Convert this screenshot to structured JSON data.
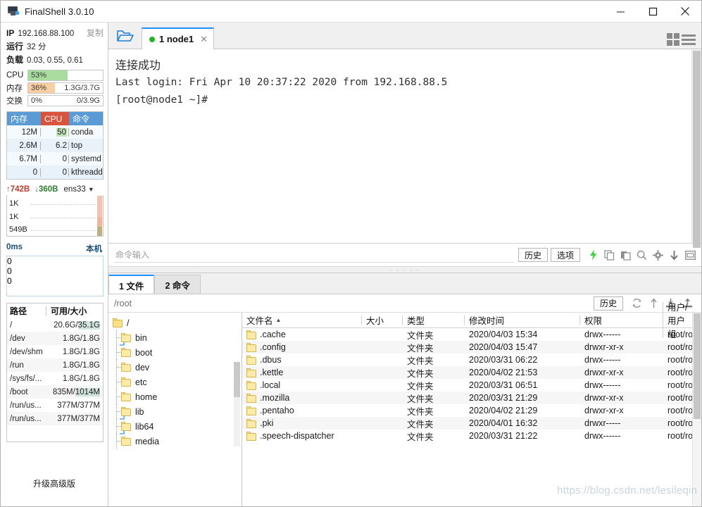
{
  "window": {
    "title": "FinalShell 3.0.10",
    "icon": "monitor-icon",
    "minimize": "–",
    "maximize": "□",
    "close": "✕"
  },
  "monitor": {
    "ip_label": "IP",
    "ip_value": "192.168.88.100",
    "copy_label": "复制",
    "uptime_label": "运行",
    "uptime_value": "32 分",
    "load_label": "负载",
    "load_value": "0.03, 0.55, 0.61",
    "meters": [
      {
        "name": "CPU",
        "pct_text": "53%",
        "pct": 53,
        "amount": "",
        "color": "#a8dd9e"
      },
      {
        "name": "内存",
        "pct_text": "36%",
        "pct": 36,
        "amount": "1.3G/3.7G",
        "color": "#fbcfa4"
      },
      {
        "name": "交换",
        "pct_text": "0%",
        "pct": 0,
        "amount": "0/3.9G",
        "color": "#cfe8f5"
      }
    ],
    "process_headers": {
      "mem": "内存",
      "cpu": "CPU",
      "cmd": "命令"
    },
    "processes": [
      {
        "mem": "12M",
        "cpu": "50",
        "cpu_hl": true,
        "cmd": "conda"
      },
      {
        "mem": "2.6M",
        "cpu": "6.2",
        "cpu_hl": false,
        "cmd": "top"
      },
      {
        "mem": "6.7M",
        "cpu": "0",
        "cpu_hl": false,
        "cmd": "systemd"
      },
      {
        "mem": "0",
        "cpu": "0",
        "cpu_hl": false,
        "cmd": "kthreadd"
      }
    ],
    "net": {
      "up_arrow": "↑",
      "up_value": "742B",
      "down_arrow": "↓",
      "down_value": "360B",
      "interface": "ens33",
      "caret": "▼",
      "axis": [
        "1K",
        "1K",
        "549B"
      ]
    },
    "latency": {
      "value": "0ms",
      "target": "本机",
      "axis": [
        "0",
        "0",
        "0"
      ]
    },
    "disk_headers": {
      "path": "路径",
      "usage": "可用/大小"
    },
    "disks": [
      {
        "path": "/",
        "free": "20.6G",
        "total": "35.1G",
        "highlight": true
      },
      {
        "path": "/dev",
        "free": "1.8G",
        "total": "1.8G",
        "highlight": false
      },
      {
        "path": "/dev/shm",
        "free": "1.8G",
        "total": "1.8G",
        "highlight": false
      },
      {
        "path": "/run",
        "free": "1.8G",
        "total": "1.8G",
        "highlight": false
      },
      {
        "path": "/sys/fs/...",
        "free": "1.8G",
        "total": "1.8G",
        "highlight": false
      },
      {
        "path": "/boot",
        "free": "835M",
        "total": "1014M",
        "highlight": true
      },
      {
        "path": "/run/us...",
        "free": "377M",
        "total": "377M",
        "highlight": false
      },
      {
        "path": "/run/us...",
        "free": "377M",
        "total": "377M",
        "highlight": false
      }
    ],
    "upgrade_label": "升级高级版"
  },
  "tabs": {
    "folder_icon": "open-folder-icon",
    "items": [
      {
        "label": "1 node1",
        "status": "connected",
        "close": "✕"
      }
    ],
    "grid_view_icon": "grid-view-icon",
    "list_view_icon": "list-view-icon"
  },
  "terminal": {
    "lines": [
      "连接成功",
      "Last login: Fri Apr 10 20:37:22 2020 from 192.168.88.5",
      "[root@node1 ~]#"
    ]
  },
  "command_bar": {
    "placeholder": "命令输入",
    "value": "",
    "history_label": "历史",
    "options_label": "选项",
    "icons": [
      "lightning-icon",
      "copy-icon",
      "paste-icon",
      "search-icon",
      "gear-icon",
      "download-icon",
      "window-icon"
    ]
  },
  "bottom_tabs": [
    {
      "label": "1 文件",
      "active": true
    },
    {
      "label": "2 命令",
      "active": false
    }
  ],
  "file_manager": {
    "path": "/root",
    "history_label": "历史",
    "icons": [
      "refresh-icon",
      "up-directory-icon",
      "download-file-icon",
      "upload-file-icon"
    ],
    "tree_root": "/",
    "tree": [
      {
        "label": "bin",
        "link": true
      },
      {
        "label": "boot",
        "link": false
      },
      {
        "label": "dev",
        "link": false
      },
      {
        "label": "etc",
        "link": false
      },
      {
        "label": "home",
        "link": false
      },
      {
        "label": "lib",
        "link": true
      },
      {
        "label": "lib64",
        "link": true
      },
      {
        "label": "media",
        "link": false
      }
    ],
    "columns": [
      {
        "key": "name",
        "label": "文件名",
        "sorted": true,
        "arrow": "▲"
      },
      {
        "key": "size",
        "label": "大小",
        "sorted": false,
        "arrow": ""
      },
      {
        "key": "type",
        "label": "类型",
        "sorted": false,
        "arrow": ""
      },
      {
        "key": "mtime",
        "label": "修改时间",
        "sorted": false,
        "arrow": ""
      },
      {
        "key": "perm",
        "label": "权限",
        "sorted": false,
        "arrow": ""
      },
      {
        "key": "owner",
        "label": "用户/用户组",
        "sorted": false,
        "arrow": ""
      }
    ],
    "files": [
      {
        "name": ".cache",
        "size": "",
        "type": "文件夹",
        "mtime": "2020/04/03 15:34",
        "perm": "drwx------",
        "owner": "root/root"
      },
      {
        "name": ".config",
        "size": "",
        "type": "文件夹",
        "mtime": "2020/04/03 15:47",
        "perm": "drwxr-xr-x",
        "owner": "root/root"
      },
      {
        "name": ".dbus",
        "size": "",
        "type": "文件夹",
        "mtime": "2020/03/31 06:22",
        "perm": "drwx------",
        "owner": "root/root"
      },
      {
        "name": ".kettle",
        "size": "",
        "type": "文件夹",
        "mtime": "2020/04/02 21:53",
        "perm": "drwxr-xr-x",
        "owner": "root/root"
      },
      {
        "name": ".local",
        "size": "",
        "type": "文件夹",
        "mtime": "2020/03/31 06:51",
        "perm": "drwx------",
        "owner": "root/root"
      },
      {
        "name": ".mozilla",
        "size": "",
        "type": "文件夹",
        "mtime": "2020/03/31 21:29",
        "perm": "drwxr-xr-x",
        "owner": "root/root"
      },
      {
        "name": ".pentaho",
        "size": "",
        "type": "文件夹",
        "mtime": "2020/04/02 21:29",
        "perm": "drwxr-xr-x",
        "owner": "root/root"
      },
      {
        "name": ".pki",
        "size": "",
        "type": "文件夹",
        "mtime": "2020/04/01 16:32",
        "perm": "drwxr-----",
        "owner": "root/root"
      },
      {
        "name": ".speech-dispatcher",
        "size": "",
        "type": "文件夹",
        "mtime": "2020/03/31 21:22",
        "perm": "drwx------",
        "owner": "root/root"
      }
    ]
  },
  "watermark": "https://blog.csdn.net/lesileqin",
  "colors": {
    "accent": "#1e90ff",
    "connected": "#22b522",
    "cpu_bar": "#a8dd9e",
    "mem_bar": "#fbcfa4",
    "header_blue": "#5b9bd5",
    "header_red": "#d9543c",
    "up": "#c0392b",
    "down": "#2e7d32"
  }
}
